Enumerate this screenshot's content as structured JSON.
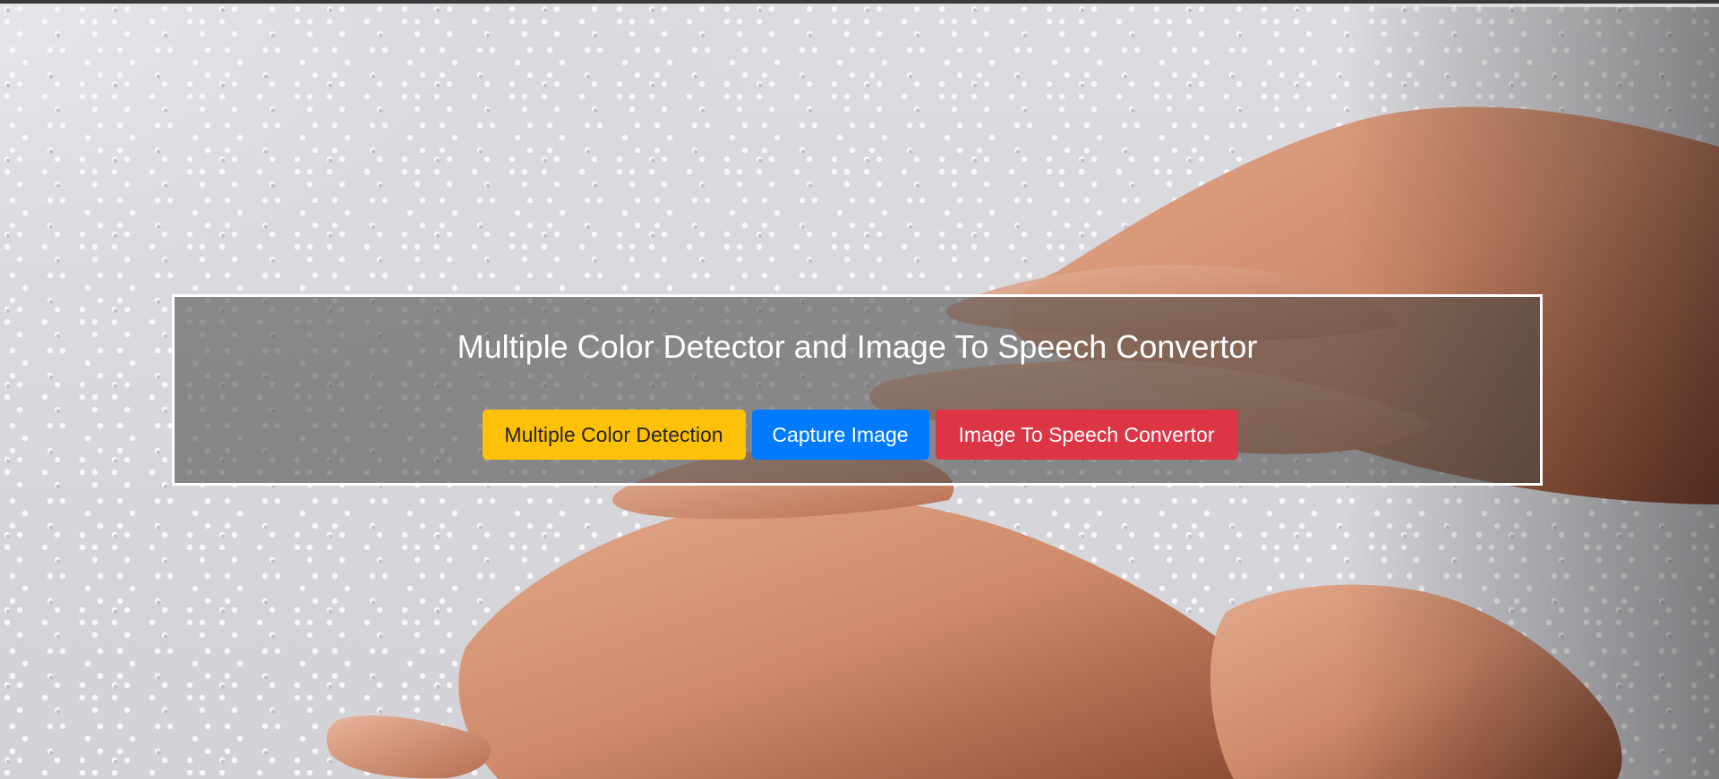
{
  "page": {
    "title": "Multiple Color Detector and Image To Speech Convertor"
  },
  "buttons": {
    "color_detection": "Multiple Color Detection",
    "capture_image": "Capture Image",
    "image_to_speech": "Image To Speech Convertor"
  },
  "colors": {
    "warning": "#ffc107",
    "primary": "#007bff",
    "danger": "#dc3545",
    "panel_border": "#ffffff"
  },
  "background": {
    "icon": "braille-hands-photo"
  }
}
